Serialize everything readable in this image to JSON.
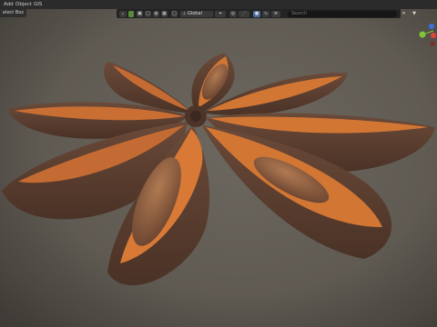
{
  "menu": {
    "add": "Add",
    "object": "Object",
    "gis": "GIS"
  },
  "select_mode": "elect Box",
  "header": {
    "transform_space": "Global",
    "search_placeholder": "Search"
  },
  "colors": {
    "viewport_bg": "#68645c",
    "pod_outer": "#5a3e30",
    "pod_rim": "#d9793a",
    "pod_inner": "#b26530",
    "seed": "#8a5c3e",
    "gizmo_x": "#e0443a",
    "gizmo_y": "#7ec53a",
    "gizmo_z": "#3b6fe0"
  }
}
